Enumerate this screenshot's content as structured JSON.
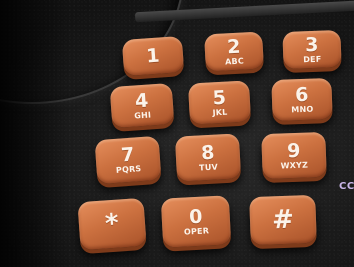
{
  "keypad": {
    "keys": [
      {
        "digit": "1",
        "letters": ""
      },
      {
        "digit": "2",
        "letters": "ABC"
      },
      {
        "digit": "3",
        "letters": "DEF"
      },
      {
        "digit": "4",
        "letters": "GHI"
      },
      {
        "digit": "5",
        "letters": "JKL"
      },
      {
        "digit": "6",
        "letters": "MNO"
      },
      {
        "digit": "7",
        "letters": "PQRS"
      },
      {
        "digit": "8",
        "letters": "TUV"
      },
      {
        "digit": "9",
        "letters": "WXYZ"
      },
      {
        "digit": "*",
        "letters": ""
      },
      {
        "digit": "0",
        "letters": "OPER"
      },
      {
        "digit": "#",
        "letters": ""
      }
    ]
  },
  "edge_text": "CC",
  "colors": {
    "key_orange": "#cc7140",
    "key_text": "#fbf3ea",
    "housing": "#1a1a1a",
    "edge_text": "#c9b6e8"
  }
}
